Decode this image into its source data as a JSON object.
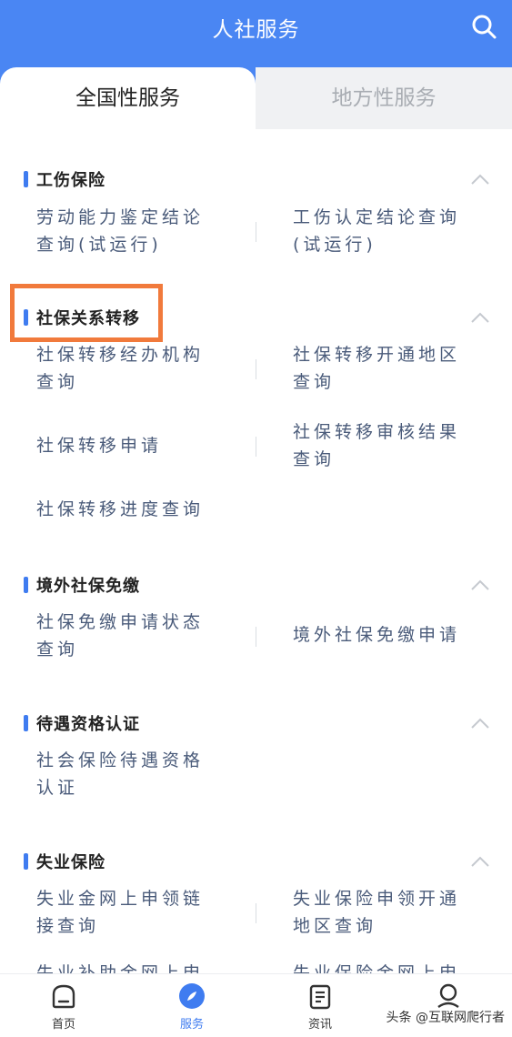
{
  "header": {
    "title": "人社服务"
  },
  "tabs": [
    {
      "label": "全国性服务"
    },
    {
      "label": "地方性服务"
    }
  ],
  "sections": [
    {
      "title": "工伤保险",
      "items": [
        {
          "line1": "劳动能力鉴定结论",
          "line2": "查询(试运行)"
        },
        {
          "line1": "工伤认定结论查询",
          "line2": "(试运行)"
        }
      ]
    },
    {
      "title": "社保关系转移",
      "items": [
        {
          "line1": "社保转移经办机构",
          "line2": "查询"
        },
        {
          "line1": "社保转移开通地区",
          "line2": "查询"
        },
        {
          "line1": "社保转移申请",
          "line2": ""
        },
        {
          "line1": "社保转移审核结果",
          "line2": "查询"
        },
        {
          "line1": "社保转移进度查询",
          "line2": ""
        }
      ]
    },
    {
      "title": "境外社保免缴",
      "items": [
        {
          "line1": "社保免缴申请状态",
          "line2": "查询"
        },
        {
          "line1": "境外社保免缴申请",
          "line2": ""
        }
      ]
    },
    {
      "title": "待遇资格认证",
      "items": [
        {
          "line1": "社会保险待遇资格",
          "line2": "认证"
        }
      ]
    },
    {
      "title": "失业保险",
      "items": [
        {
          "line1": "失业金网上申领链",
          "line2": "接查询"
        },
        {
          "line1": "失业保险申领开通",
          "line2": "地区查询"
        },
        {
          "line1": "失业补助金网上申",
          "line2": ""
        },
        {
          "line1": "失业保险金网上申",
          "line2": ""
        }
      ]
    }
  ],
  "bottom_nav": [
    {
      "label": "首页",
      "icon": "home-icon"
    },
    {
      "label": "服务",
      "icon": "compass-icon",
      "active": true
    },
    {
      "label": "资讯",
      "icon": "news-icon"
    },
    {
      "label": "",
      "icon": "user-icon"
    }
  ],
  "watermark": "头条 @互联网爬行者",
  "colors": {
    "header": "#4a86f3",
    "accent": "#3f7cf0",
    "highlight": "#f17a3c",
    "item_text": "#4a5b7a"
  }
}
